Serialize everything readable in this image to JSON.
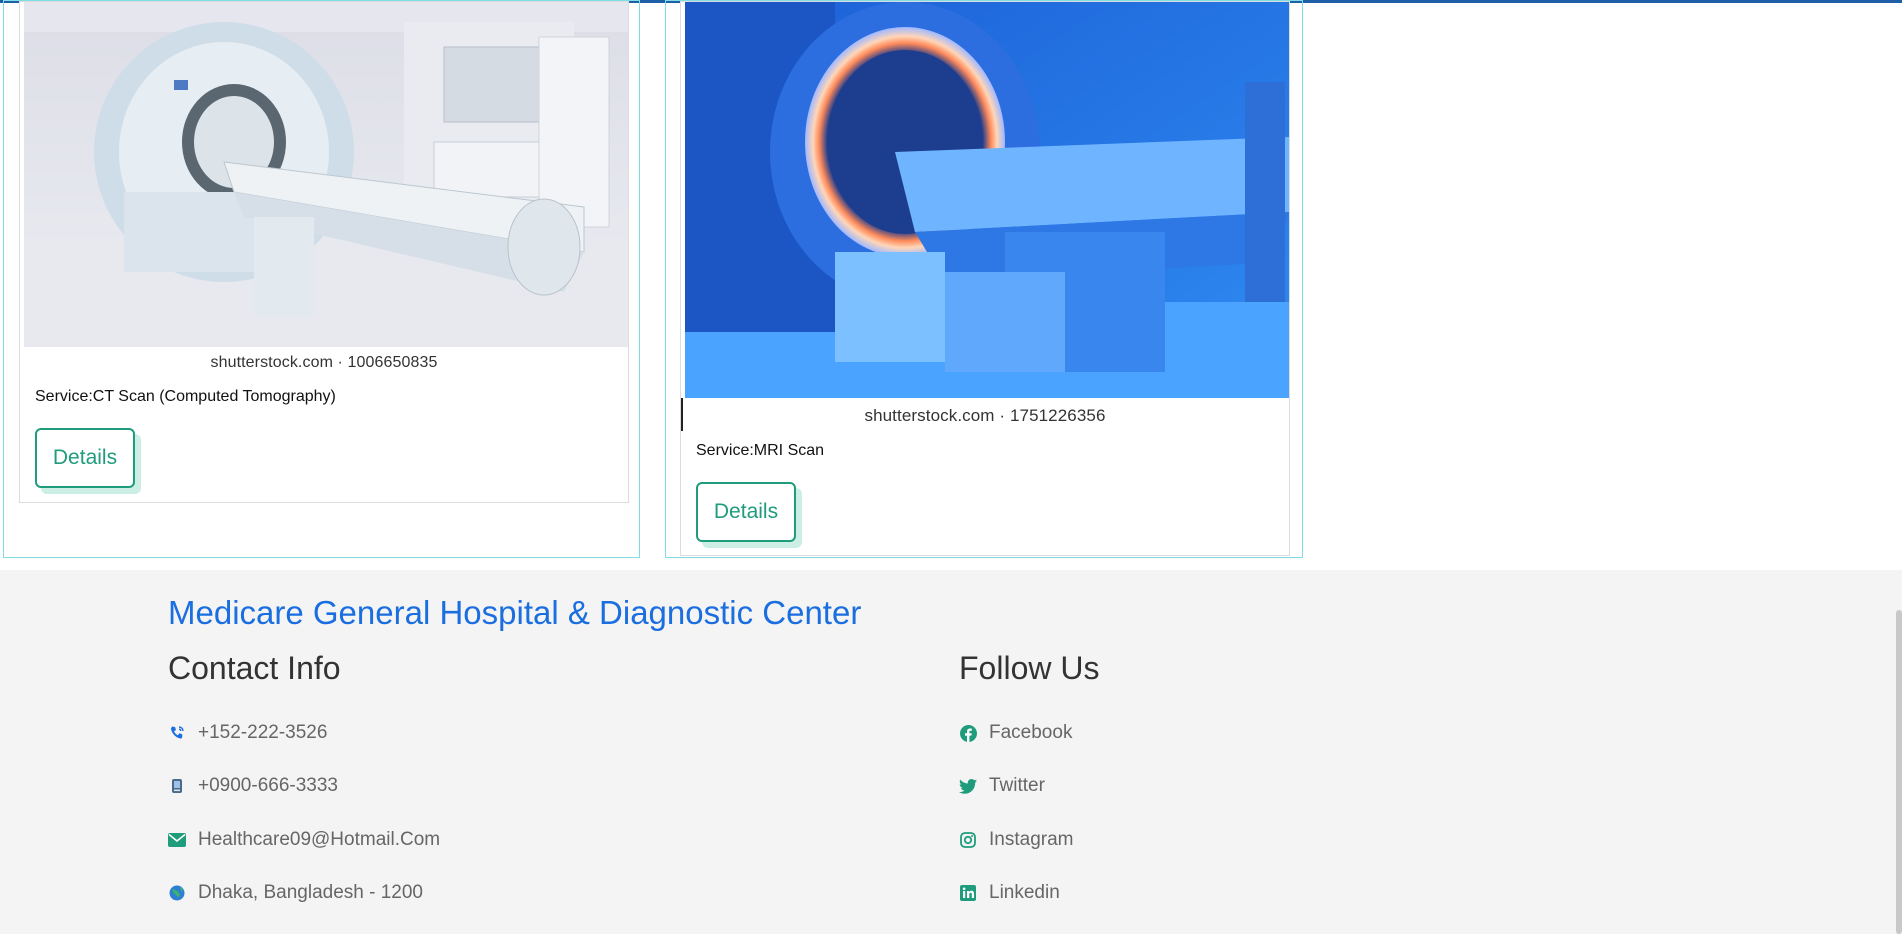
{
  "services": [
    {
      "watermark": "shutterstock.com · 1006650835",
      "service_label": "Service:CT Scan (Computed Tomography)",
      "button_label": "Details"
    },
    {
      "watermark": "shutterstock.com · 1751226356",
      "service_label": "Service:MRI Scan",
      "button_label": "Details"
    }
  ],
  "footer": {
    "brand": "Medicare General Hospital & Diagnostic Center",
    "contact_title": "Contact Info",
    "contacts": [
      {
        "icon": "phone-icon",
        "text": "+152-222-3526"
      },
      {
        "icon": "mobile-icon",
        "text": "+0900-666-3333"
      },
      {
        "icon": "envelope-icon",
        "text": "Healthcare09@Hotmail.Com"
      },
      {
        "icon": "globe-icon",
        "text": "Dhaka, Bangladesh - 1200"
      }
    ],
    "follow_title": "Follow Us",
    "socials": [
      {
        "icon": "facebook-icon",
        "text": "Facebook"
      },
      {
        "icon": "twitter-icon",
        "text": "Twitter"
      },
      {
        "icon": "instagram-icon",
        "text": "Instagram"
      },
      {
        "icon": "linkedin-icon",
        "text": "Linkedin"
      }
    ]
  },
  "colors": {
    "accent_green": "#1f9c7c",
    "brand_blue": "#1a6ee0",
    "card_border": "#7fdde5"
  }
}
